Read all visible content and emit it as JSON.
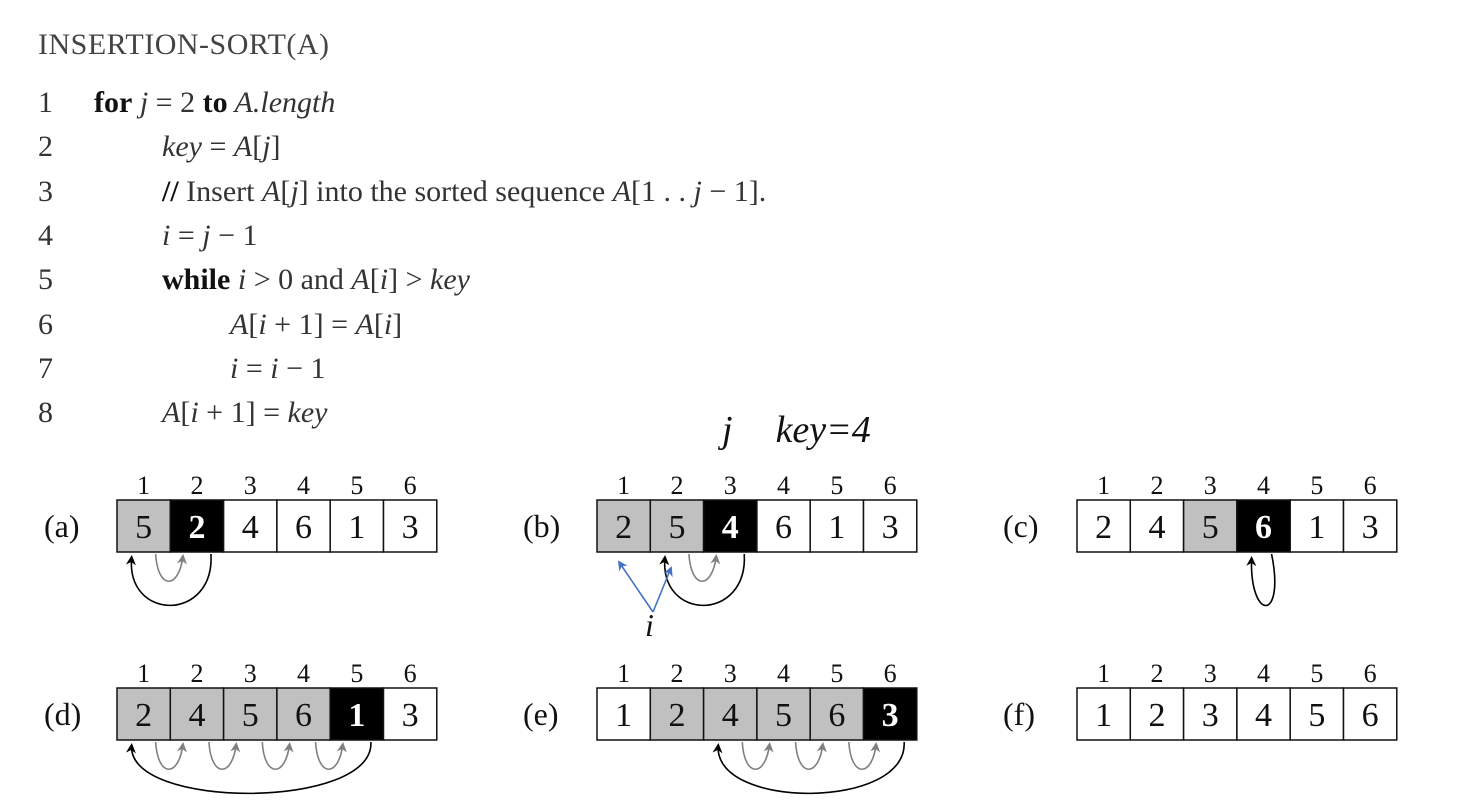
{
  "title": "INSERTION-SORT(A)",
  "code": [
    {
      "num": "1",
      "indent": 0,
      "parts": [
        [
          "kw",
          "for"
        ],
        [
          "it",
          " j"
        ],
        [
          "n",
          " = 2 "
        ],
        [
          "kw",
          "to"
        ],
        [
          "it",
          " A.length"
        ]
      ]
    },
    {
      "num": "2",
      "indent": 1,
      "parts": [
        [
          "it",
          "key"
        ],
        [
          "n",
          " = "
        ],
        [
          "it",
          "A"
        ],
        [
          "n",
          "["
        ],
        [
          "it",
          "j"
        ],
        [
          "n",
          "]"
        ]
      ]
    },
    {
      "num": "3",
      "indent": 1,
      "parts": [
        [
          "kw",
          "//"
        ],
        [
          "n",
          " Insert "
        ],
        [
          "it",
          "A"
        ],
        [
          "n",
          "["
        ],
        [
          "it",
          "j"
        ],
        [
          "n",
          "] into the sorted sequence "
        ],
        [
          "it",
          "A"
        ],
        [
          "n",
          "[1 . . "
        ],
        [
          "it",
          "j"
        ],
        [
          "n",
          " − 1]."
        ]
      ]
    },
    {
      "num": "4",
      "indent": 1,
      "parts": [
        [
          "it",
          "i"
        ],
        [
          "n",
          " = "
        ],
        [
          "it",
          "j"
        ],
        [
          "n",
          " − 1"
        ]
      ]
    },
    {
      "num": "5",
      "indent": 1,
      "parts": [
        [
          "kw",
          "while"
        ],
        [
          "it",
          " i"
        ],
        [
          "n",
          " > 0 and "
        ],
        [
          "it",
          "A"
        ],
        [
          "n",
          "["
        ],
        [
          "it",
          "i"
        ],
        [
          "n",
          "] > "
        ],
        [
          "it",
          "key"
        ]
      ]
    },
    {
      "num": "6",
      "indent": 2,
      "parts": [
        [
          "it",
          "A"
        ],
        [
          "n",
          "["
        ],
        [
          "it",
          "i"
        ],
        [
          "n",
          " + 1] = "
        ],
        [
          "it",
          "A"
        ],
        [
          "n",
          "["
        ],
        [
          "it",
          "i"
        ],
        [
          "n",
          "]"
        ]
      ]
    },
    {
      "num": "7",
      "indent": 2,
      "parts": [
        [
          "it",
          "i"
        ],
        [
          "n",
          " = "
        ],
        [
          "it",
          "i"
        ],
        [
          "n",
          " − 1"
        ]
      ]
    },
    {
      "num": "8",
      "indent": 1,
      "parts": [
        [
          "it",
          "A"
        ],
        [
          "n",
          "["
        ],
        [
          "it",
          "i"
        ],
        [
          "n",
          " + 1] = "
        ],
        [
          "it",
          "key"
        ]
      ]
    }
  ],
  "annotation": {
    "j_label": "j",
    "key_label": "key=4"
  },
  "i_pointer_label": "i",
  "indices": [
    "1",
    "2",
    "3",
    "4",
    "5",
    "6"
  ],
  "colors": {
    "gray": "#c0c0c0",
    "black": "#000000",
    "white": "#ffffff",
    "blue": "#4472c4",
    "arrow_gray": "#808080"
  },
  "arrays": [
    {
      "label": "(a)",
      "cells": [
        {
          "v": "5",
          "s": "gray"
        },
        {
          "v": "2",
          "s": "black"
        },
        {
          "v": "4",
          "s": "white"
        },
        {
          "v": "6",
          "s": "white"
        },
        {
          "v": "1",
          "s": "white"
        },
        {
          "v": "3",
          "s": "white"
        }
      ],
      "gray_arrows": [
        [
          0,
          1
        ]
      ],
      "black_arrow": [
        1,
        0
      ],
      "blue_pointer": false
    },
    {
      "label": "(b)",
      "cells": [
        {
          "v": "2",
          "s": "gray"
        },
        {
          "v": "5",
          "s": "gray"
        },
        {
          "v": "4",
          "s": "black"
        },
        {
          "v": "6",
          "s": "white"
        },
        {
          "v": "1",
          "s": "white"
        },
        {
          "v": "3",
          "s": "white"
        }
      ],
      "gray_arrows": [
        [
          1,
          2
        ]
      ],
      "black_arrow": [
        2,
        1
      ],
      "blue_pointer": true
    },
    {
      "label": "(c)",
      "cells": [
        {
          "v": "2",
          "s": "white"
        },
        {
          "v": "4",
          "s": "white"
        },
        {
          "v": "5",
          "s": "gray"
        },
        {
          "v": "6",
          "s": "black"
        },
        {
          "v": "1",
          "s": "white"
        },
        {
          "v": "3",
          "s": "white"
        }
      ],
      "gray_arrows": [],
      "black_arrow": [
        3,
        3
      ],
      "blue_pointer": false
    },
    {
      "label": "(d)",
      "cells": [
        {
          "v": "2",
          "s": "gray"
        },
        {
          "v": "4",
          "s": "gray"
        },
        {
          "v": "5",
          "s": "gray"
        },
        {
          "v": "6",
          "s": "gray"
        },
        {
          "v": "1",
          "s": "black"
        },
        {
          "v": "3",
          "s": "white"
        }
      ],
      "gray_arrows": [
        [
          0,
          1
        ],
        [
          1,
          2
        ],
        [
          2,
          3
        ],
        [
          3,
          4
        ]
      ],
      "black_arrow": [
        4,
        0
      ],
      "blue_pointer": false
    },
    {
      "label": "(e)",
      "cells": [
        {
          "v": "1",
          "s": "white"
        },
        {
          "v": "2",
          "s": "gray"
        },
        {
          "v": "4",
          "s": "gray"
        },
        {
          "v": "5",
          "s": "gray"
        },
        {
          "v": "6",
          "s": "gray"
        },
        {
          "v": "3",
          "s": "black"
        }
      ],
      "gray_arrows": [
        [
          2,
          3
        ],
        [
          3,
          4
        ],
        [
          4,
          5
        ]
      ],
      "black_arrow": [
        5,
        2
      ],
      "blue_pointer": false
    },
    {
      "label": "(f)",
      "cells": [
        {
          "v": "1",
          "s": "white"
        },
        {
          "v": "2",
          "s": "white"
        },
        {
          "v": "3",
          "s": "white"
        },
        {
          "v": "4",
          "s": "white"
        },
        {
          "v": "5",
          "s": "white"
        },
        {
          "v": "6",
          "s": "white"
        }
      ],
      "gray_arrows": [],
      "black_arrow": null,
      "blue_pointer": false
    }
  ]
}
